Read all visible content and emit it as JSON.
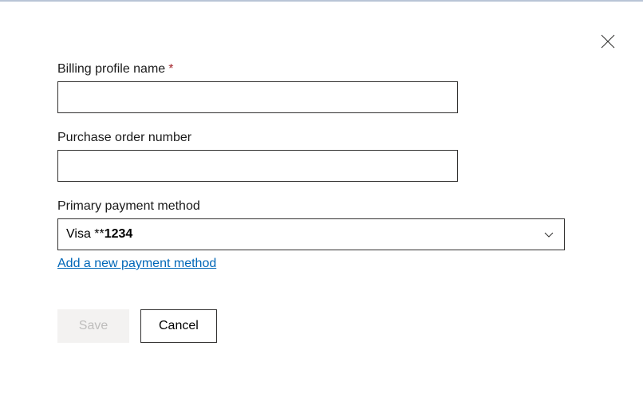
{
  "form": {
    "billing_profile": {
      "label": "Billing profile name",
      "required_marker": "*",
      "value": ""
    },
    "purchase_order": {
      "label": "Purchase order number",
      "value": ""
    },
    "payment_method": {
      "label": "Primary payment method",
      "selected_prefix": "Visa **",
      "selected_number": "1234"
    },
    "add_payment_link": "Add a new payment method"
  },
  "buttons": {
    "save": "Save",
    "cancel": "Cancel"
  }
}
